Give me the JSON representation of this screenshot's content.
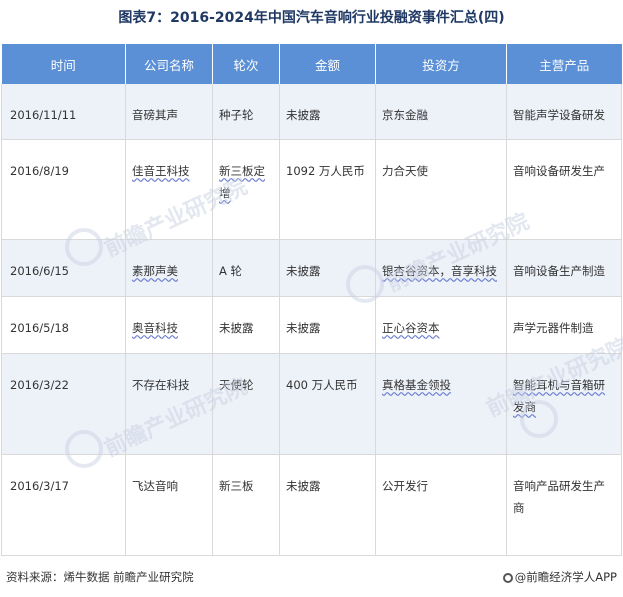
{
  "title": "图表7：2016-2024年中国汽车音响行业投融资事件汇总(四)",
  "table": {
    "headers": [
      "时间",
      "公司名称",
      "轮次",
      "金额",
      "投资方",
      "主营产品"
    ],
    "rows": [
      [
        "2016/11/11",
        "音磅其声",
        "种子轮",
        "未披露",
        "京东金融",
        "智能声学设备研发"
      ],
      [
        "2016/8/19",
        "佳音王科技",
        "新三板定增",
        "1092 万人民币",
        "力合天使",
        "音响设备研发生产"
      ],
      [
        "2016/6/15",
        "素那声美",
        "A 轮",
        "未披露",
        "银杏谷资本，音享科技",
        "音响设备生产制造"
      ],
      [
        "2016/5/18",
        "奥音科技",
        "未披露",
        "未披露",
        "正心谷资本",
        "声学元器件制造"
      ],
      [
        "2016/3/22",
        "不存在科技",
        "天使轮",
        "400 万人民币",
        "真格基金领投",
        "智能耳机与音箱研发商"
      ],
      [
        "2016/3/17",
        "飞达音响",
        "新三板",
        "未披露",
        "公开发行",
        "音响产品研发生产商"
      ]
    ]
  },
  "watermark": "前瞻产业研究院",
  "footer": {
    "source": "资料来源：烯牛数据 前瞻产业研究院",
    "brand": "@前瞻经济学人APP"
  }
}
